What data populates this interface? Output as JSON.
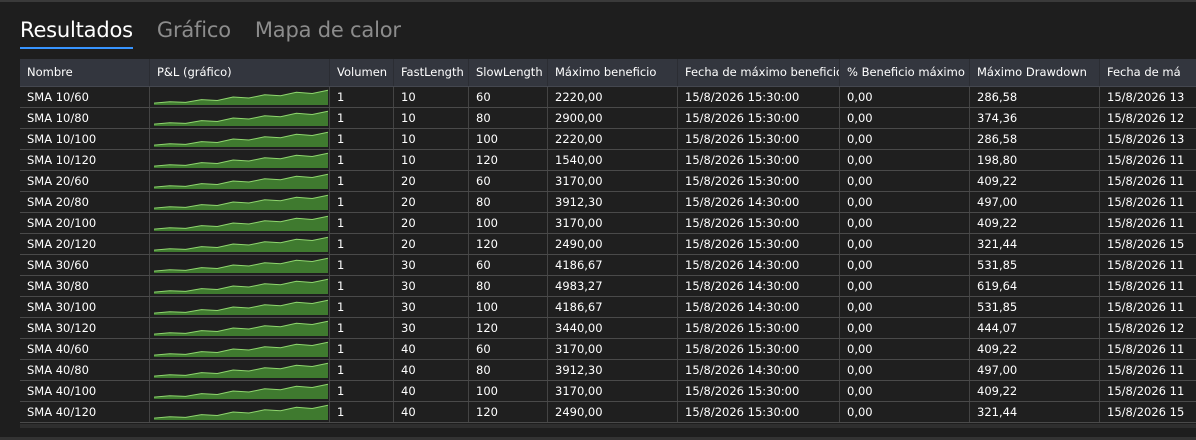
{
  "tabs": [
    {
      "label": "Resultados",
      "active": true
    },
    {
      "label": "Gráfico",
      "active": false
    },
    {
      "label": "Mapa de calor",
      "active": false
    }
  ],
  "table": {
    "columns": [
      "Nombre",
      "P&L (gráfico)",
      "Volumen",
      "FastLength",
      "SlowLength",
      "Máximo beneficio",
      "Fecha de máximo beneficio",
      "% Beneficio máximo",
      "Máximo Drawdown",
      "Fecha de má"
    ],
    "rows": [
      {
        "nombre": "SMA 10/60",
        "volumen": "1",
        "fast": "10",
        "slow": "60",
        "max_beneficio": "2220,00",
        "fecha_max": "15/8/2026 15:30:00",
        "pct": "0,00",
        "drawdown": "286,58",
        "fecha_dd": "15/8/2026 13"
      },
      {
        "nombre": "SMA 10/80",
        "volumen": "1",
        "fast": "10",
        "slow": "80",
        "max_beneficio": "2900,00",
        "fecha_max": "15/8/2026 15:30:00",
        "pct": "0,00",
        "drawdown": "374,36",
        "fecha_dd": "15/8/2026 12"
      },
      {
        "nombre": "SMA 10/100",
        "volumen": "1",
        "fast": "10",
        "slow": "100",
        "max_beneficio": "2220,00",
        "fecha_max": "15/8/2026 15:30:00",
        "pct": "0,00",
        "drawdown": "286,58",
        "fecha_dd": "15/8/2026 13"
      },
      {
        "nombre": "SMA 10/120",
        "volumen": "1",
        "fast": "10",
        "slow": "120",
        "max_beneficio": "1540,00",
        "fecha_max": "15/8/2026 15:30:00",
        "pct": "0,00",
        "drawdown": "198,80",
        "fecha_dd": "15/8/2026 11"
      },
      {
        "nombre": "SMA 20/60",
        "volumen": "1",
        "fast": "20",
        "slow": "60",
        "max_beneficio": "3170,00",
        "fecha_max": "15/8/2026 15:30:00",
        "pct": "0,00",
        "drawdown": "409,22",
        "fecha_dd": "15/8/2026 11"
      },
      {
        "nombre": "SMA 20/80",
        "volumen": "1",
        "fast": "20",
        "slow": "80",
        "max_beneficio": "3912,30",
        "fecha_max": "15/8/2026 14:30:00",
        "pct": "0,00",
        "drawdown": "497,00",
        "fecha_dd": "15/8/2026 11"
      },
      {
        "nombre": "SMA 20/100",
        "volumen": "1",
        "fast": "20",
        "slow": "100",
        "max_beneficio": "3170,00",
        "fecha_max": "15/8/2026 15:30:00",
        "pct": "0,00",
        "drawdown": "409,22",
        "fecha_dd": "15/8/2026 11"
      },
      {
        "nombre": "SMA 20/120",
        "volumen": "1",
        "fast": "20",
        "slow": "120",
        "max_beneficio": "2490,00",
        "fecha_max": "15/8/2026 15:30:00",
        "pct": "0,00",
        "drawdown": "321,44",
        "fecha_dd": "15/8/2026 15"
      },
      {
        "nombre": "SMA 30/60",
        "volumen": "1",
        "fast": "30",
        "slow": "60",
        "max_beneficio": "4186,67",
        "fecha_max": "15/8/2026 14:30:00",
        "pct": "0,00",
        "drawdown": "531,85",
        "fecha_dd": "15/8/2026 11"
      },
      {
        "nombre": "SMA 30/80",
        "volumen": "1",
        "fast": "30",
        "slow": "80",
        "max_beneficio": "4983,27",
        "fecha_max": "15/8/2026 14:30:00",
        "pct": "0,00",
        "drawdown": "619,64",
        "fecha_dd": "15/8/2026 11"
      },
      {
        "nombre": "SMA 30/100",
        "volumen": "1",
        "fast": "30",
        "slow": "100",
        "max_beneficio": "4186,67",
        "fecha_max": "15/8/2026 14:30:00",
        "pct": "0,00",
        "drawdown": "531,85",
        "fecha_dd": "15/8/2026 11"
      },
      {
        "nombre": "SMA 30/120",
        "volumen": "1",
        "fast": "30",
        "slow": "120",
        "max_beneficio": "3440,00",
        "fecha_max": "15/8/2026 15:30:00",
        "pct": "0,00",
        "drawdown": "444,07",
        "fecha_dd": "15/8/2026 12"
      },
      {
        "nombre": "SMA 40/60",
        "volumen": "1",
        "fast": "40",
        "slow": "60",
        "max_beneficio": "3170,00",
        "fecha_max": "15/8/2026 15:30:00",
        "pct": "0,00",
        "drawdown": "409,22",
        "fecha_dd": "15/8/2026 11"
      },
      {
        "nombre": "SMA 40/80",
        "volumen": "1",
        "fast": "40",
        "slow": "80",
        "max_beneficio": "3912,30",
        "fecha_max": "15/8/2026 14:30:00",
        "pct": "0,00",
        "drawdown": "497,00",
        "fecha_dd": "15/8/2026 11"
      },
      {
        "nombre": "SMA 40/100",
        "volumen": "1",
        "fast": "40",
        "slow": "100",
        "max_beneficio": "3170,00",
        "fecha_max": "15/8/2026 15:30:00",
        "pct": "0,00",
        "drawdown": "409,22",
        "fecha_dd": "15/8/2026 11"
      },
      {
        "nombre": "SMA 40/120",
        "volumen": "1",
        "fast": "40",
        "slow": "120",
        "max_beneficio": "2490,00",
        "fecha_max": "15/8/2026 15:30:00",
        "pct": "0,00",
        "drawdown": "321,44",
        "fecha_dd": "15/8/2026 15"
      }
    ]
  },
  "colors": {
    "accent": "#3794ff",
    "sparkline_fill": "#3f7a2f",
    "sparkline_line": "#8fd66e"
  },
  "sparkline_shape": [
    0.12,
    0.2,
    0.16,
    0.34,
    0.28,
    0.5,
    0.44,
    0.64,
    0.58,
    0.8,
    0.72,
    0.92
  ]
}
